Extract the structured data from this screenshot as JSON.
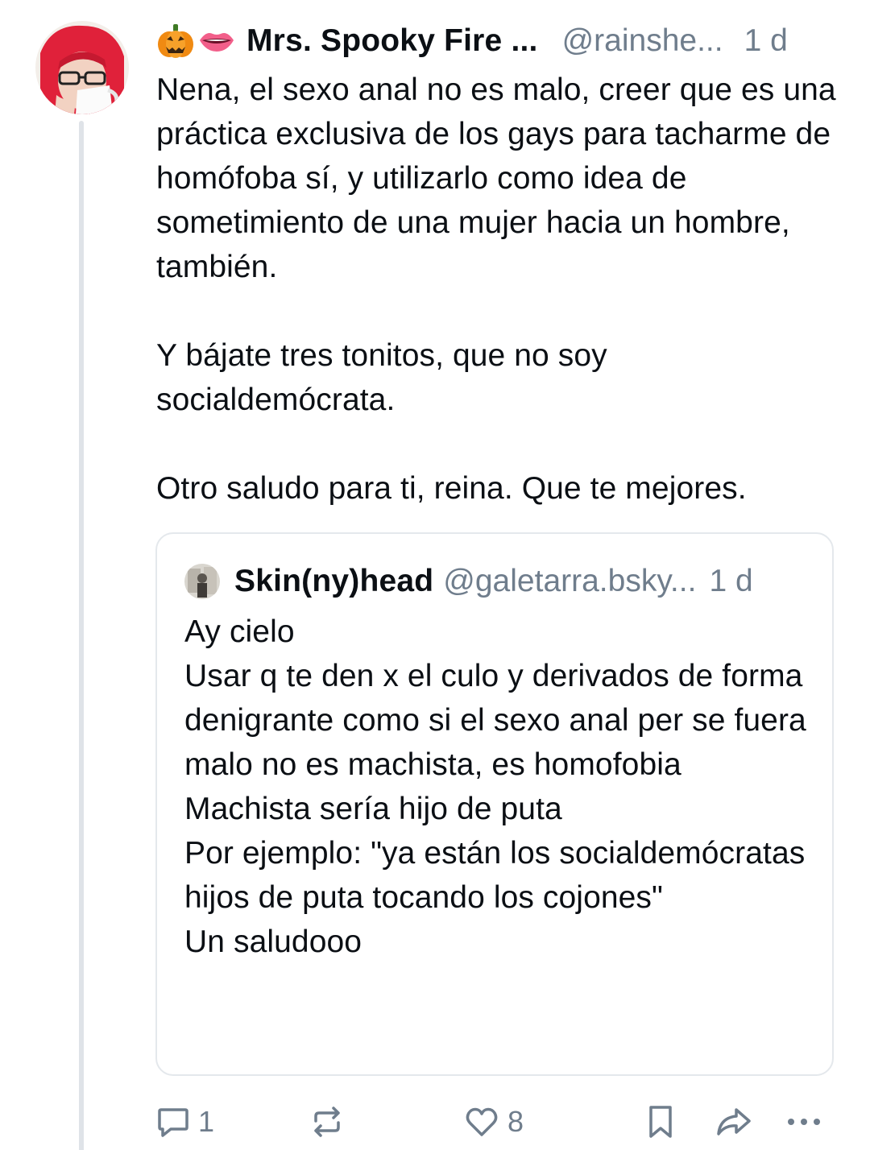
{
  "post": {
    "author_emoji": [
      "pumpkin-icon",
      "lips-icon"
    ],
    "display_name": "Mrs. Spooky Fire ...",
    "handle": "@rainshe...",
    "time": "1 d",
    "text": "Nena, el sexo anal no es malo, creer que es una práctica exclusiva de los gays para tacharme de homófoba sí, y utilizarlo como idea de sometimiento de una mujer hacia un hombre, también.\n\nY bájate tres tonitos, que no soy socialdemócrata.\n\nOtro saludo para ti, reina. Que te mejores."
  },
  "quote": {
    "display_name": "Skin(ny)head",
    "handle": "@galetarra.bsky...",
    "time": "1 d",
    "text": "Ay cielo\nUsar q te den x el culo y derivados de forma denigrante como si el sexo anal per se fuera malo no es machista, es homofobia\nMachista sería hijo de puta\nPor ejemplo: \"ya están los socialdemócratas hijos de puta tocando los cojones\"\nUn saludooo"
  },
  "actions": {
    "reply_count": "1",
    "repost_count": "",
    "like_count": "8"
  },
  "colors": {
    "text": "#0b0f14",
    "muted": "#6f7d8c",
    "border": "#e4e8ec",
    "thread_line": "#dfe3e8",
    "avatar_hair": "#e0213a"
  }
}
